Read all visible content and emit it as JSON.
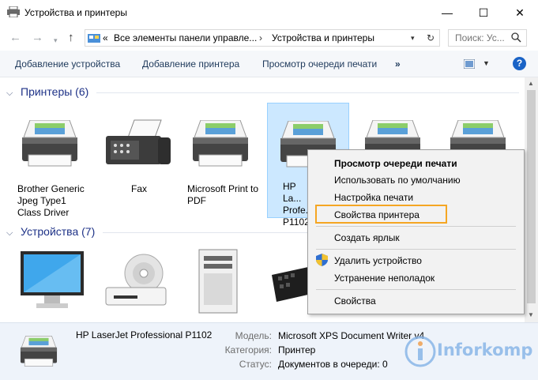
{
  "window": {
    "title": "Устройства и принтеры",
    "controls": {
      "minimize": "—",
      "maximize": "☐",
      "close": "✕"
    }
  },
  "address": {
    "prefix": "«",
    "crumbs": [
      "Все элементы панели управле...",
      "Устройства и принтеры"
    ],
    "search_placeholder": "Поиск: Ус..."
  },
  "toolbar": {
    "add_device": "Добавление устройства",
    "add_printer": "Добавление принтера",
    "print_queue": "Просмотр очереди печати",
    "more": "»",
    "help": "?"
  },
  "groups": {
    "printers": {
      "title": "Принтеры (6)"
    },
    "devices": {
      "title": "Устройства (7)"
    }
  },
  "printers": [
    {
      "label": "Brother Generic Jpeg Type1 Class Driver"
    },
    {
      "label": "Fax"
    },
    {
      "label": "Microsoft Print to PDF"
    },
    {
      "label": "HP La... Profe... P1102"
    },
    {
      "label": ""
    },
    {
      "label": ""
    }
  ],
  "context_menu": {
    "items": [
      "Просмотр очереди печати",
      "Использовать по умолчанию",
      "Настройка печати",
      "Свойства принтера",
      "Создать ярлык",
      "Удалить устройство",
      "Устранение неполадок",
      "Свойства"
    ]
  },
  "details": {
    "device_name": "HP LaserJet Professional P1102",
    "model_label": "Модель:",
    "model_value": "Microsoft XPS Document Writer v4",
    "category_label": "Категория:",
    "category_value": "Принтер",
    "status_label": "Статус:",
    "status_value": "Документов в очереди: 0"
  },
  "watermark": {
    "text": "Inforkomp"
  },
  "colors": {
    "accent": "#1e3287",
    "selection": "#cce8ff",
    "highlight_box": "#f5a623",
    "details_bg": "#eef3fa"
  }
}
